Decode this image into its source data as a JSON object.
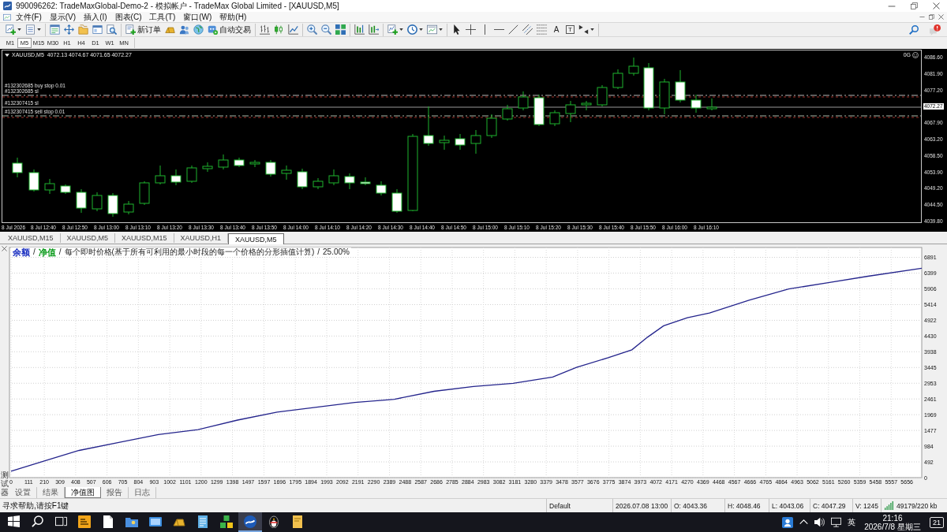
{
  "window": {
    "title": "990096262: TradeMaxGlobal-Demo-2 - 模拟帐户 - TradeMax Global Limited - [XAUUSD,M5]"
  },
  "menu": [
    "文件(F)",
    "显示(V)",
    "插入(I)",
    "图表(C)",
    "工具(T)",
    "窗口(W)",
    "帮助(H)"
  ],
  "toolbar": {
    "new_order": "新订单",
    "auto_trading": "自动交易",
    "text_tool": "A",
    "label_tool": "T"
  },
  "timeframes": [
    {
      "label": "M1",
      "selected": false
    },
    {
      "label": "M5",
      "selected": true
    },
    {
      "label": "M15",
      "selected": false
    },
    {
      "label": "M30",
      "selected": false
    },
    {
      "label": "H1",
      "selected": false
    },
    {
      "label": "H4",
      "selected": false
    },
    {
      "label": "D1",
      "selected": false
    },
    {
      "label": "W1",
      "selected": false
    },
    {
      "label": "MN",
      "selected": false
    }
  ],
  "chart": {
    "header": "XAUUSD,M5  4072.13 4074.67 4071.65 4072.27",
    "expert": "0G",
    "order_labels": [
      "#132302685 buy stop 0.01",
      "#132302685 sl",
      "#132307415 sl",
      "#132307415 sell stop 0.01"
    ],
    "price_axis": [
      {
        "text": "4086.60",
        "kind": "tick"
      },
      {
        "text": "4081.90",
        "kind": "tick"
      },
      {
        "text": "4077.20",
        "kind": "tick"
      },
      {
        "text": "4072.27",
        "kind": "current"
      },
      {
        "text": "4067.90",
        "kind": "tick"
      },
      {
        "text": "4063.20",
        "kind": "tick"
      },
      {
        "text": "4058.50",
        "kind": "tick"
      },
      {
        "text": "4053.90",
        "kind": "tick"
      },
      {
        "text": "4049.20",
        "kind": "tick"
      },
      {
        "text": "4044.50",
        "kind": "tick"
      },
      {
        "text": "4039.80",
        "kind": "tick"
      }
    ],
    "time_axis": [
      "8 Jul 2026",
      "8 Jul 12:40",
      "8 Jul 12:50",
      "8 Jul 13:00",
      "8 Jul 13:10",
      "8 Jul 13:20",
      "8 Jul 13:30",
      "8 Jul 13:40",
      "8 Jul 13:50",
      "8 Jul 14:00",
      "8 Jul 14:10",
      "8 Jul 14:20",
      "8 Jul 14:30",
      "8 Jul 14:40",
      "8 Jul 14:50",
      "8 Jul 15:00",
      "8 Jul 15:10",
      "8 Jul 15:20",
      "8 Jul 15:30",
      "8 Jul 15:40",
      "8 Jul 15:50",
      "8 Jul 16:00",
      "8 Jul 16:10"
    ]
  },
  "chart_tabs": [
    {
      "label": "XAUUSD,M15",
      "selected": false
    },
    {
      "label": "XAUUSD,M5",
      "selected": false
    },
    {
      "label": "XAUUSD,M15",
      "selected": false
    },
    {
      "label": "XAUUSD,H1",
      "selected": false
    },
    {
      "label": "XAUUSD,M5",
      "selected": true
    }
  ],
  "tester": {
    "side_label": "测试器",
    "legend": [
      {
        "label": "余额",
        "color": "#1a2fc0"
      },
      {
        "label": "净值",
        "color": "#0a9a1a"
      }
    ],
    "separator": "/",
    "model": "每个即时价格(基于所有可利用的最小时段的每一个价格的分形插值计算)",
    "quality": "25.00%",
    "chart_data": {
      "type": "line",
      "x": [
        0,
        230,
        430,
        680,
        930,
        1180,
        1430,
        1680,
        1920,
        2170,
        2420,
        2670,
        2920,
        3170,
        3420,
        3570,
        3770,
        3920,
        4020,
        4120,
        4270,
        4410,
        4660,
        4910,
        5160,
        5410,
        5750
      ],
      "values": [
        200,
        550,
        850,
        1100,
        1350,
        1500,
        1800,
        2050,
        2200,
        2350,
        2450,
        2700,
        2850,
        2950,
        3150,
        3450,
        3750,
        4000,
        4400,
        4750,
        5000,
        5150,
        5550,
        5900,
        6100,
        6300,
        6550
      ],
      "xlim": [
        0,
        5750
      ],
      "ylim": [
        0,
        7200
      ],
      "xticks": [
        0,
        111,
        210,
        309,
        408,
        507,
        606,
        705,
        804,
        903,
        1002,
        1101,
        1200,
        1299,
        1398,
        1497,
        1597,
        1696,
        1795,
        1894,
        1993,
        2092,
        2191,
        2290,
        2389,
        2488,
        2587,
        2686,
        2785,
        2884,
        2983,
        3082,
        3181,
        3280,
        3379,
        3478,
        3577,
        3676,
        3775,
        3874,
        3973,
        4072,
        4171,
        4270,
        4369,
        4468,
        4567,
        4666,
        4765,
        4864,
        4963,
        5062,
        5161,
        5260,
        5359,
        5458,
        5557,
        5656
      ],
      "yticks": [
        0,
        492,
        984,
        1477,
        1969,
        2461,
        2953,
        3445,
        3938,
        4430,
        4922,
        5414,
        5906,
        6399,
        6891
      ],
      "grid": true
    },
    "tabs": [
      {
        "label": "设置",
        "selected": false
      },
      {
        "label": "结果",
        "selected": false
      },
      {
        "label": "净值图",
        "selected": true
      },
      {
        "label": "报告",
        "selected": false
      },
      {
        "label": "日志",
        "selected": false
      }
    ]
  },
  "status_bar": {
    "help": "寻求帮助,请按F1键",
    "profile": "Default",
    "time": "2026.07.08 13:00",
    "open": "O: 4043.36",
    "high": "H: 4048.46",
    "low": "L: 4043.06",
    "close": "C: 4047.29",
    "volume": "V: 1245",
    "traffic": "49179/220 kb"
  },
  "taskbar": {
    "apps": [
      {
        "active": false
      },
      {
        "active": false
      },
      {
        "active": false
      },
      {
        "active": false
      },
      {
        "active": false
      },
      {
        "active": false
      },
      {
        "active": false
      },
      {
        "active": true
      },
      {
        "active": false
      },
      {
        "active": false
      }
    ],
    "input_method": "英",
    "time": "21:16",
    "date": "2026/7/8 星期三",
    "notifications": "21"
  }
}
